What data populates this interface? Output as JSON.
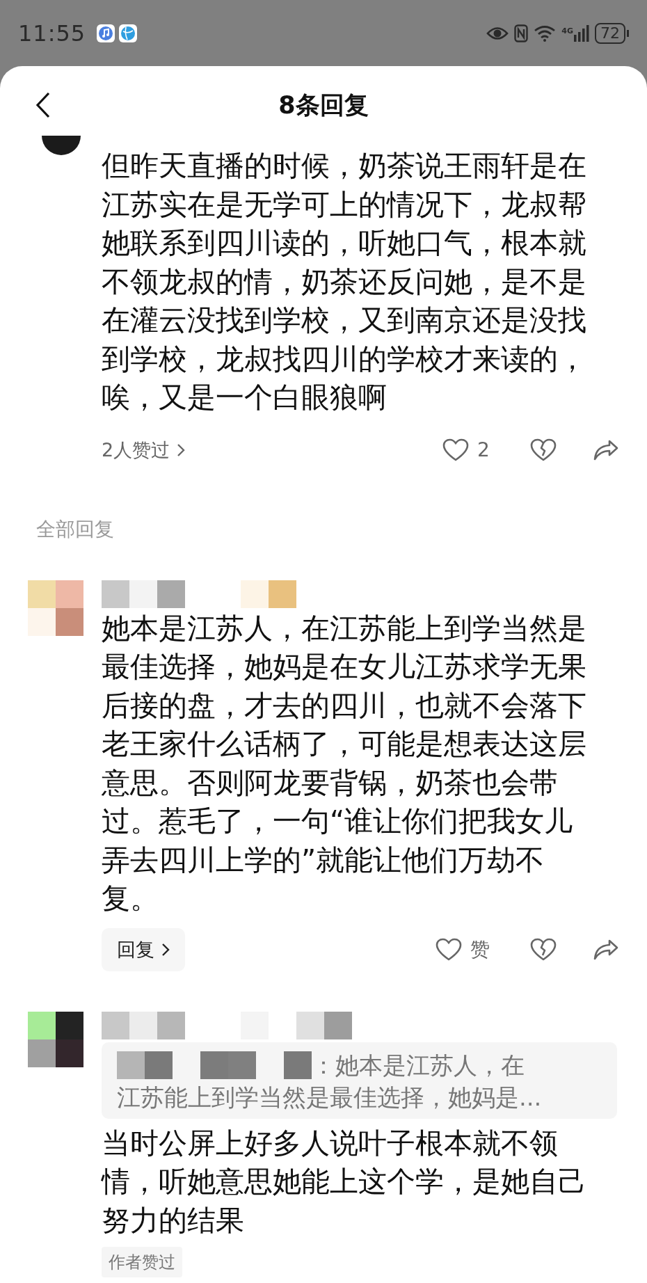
{
  "status_bar": {
    "time": "11:55",
    "network": "4G",
    "battery": "72"
  },
  "header": {
    "title": "8条回复"
  },
  "top_comment": {
    "text": "但昨天直播的时候，奶茶说王雨轩是在江苏实在是无学可上的情况下，龙叔帮她联系到四川读的，听她口气，根本就不领龙叔的情，奶茶还反问她，是不是在灌云没找到学校，又到南京还是没找到学校，龙叔找四川的学校才来读的，唉，又是一个白眼狼啊",
    "likers": "2人赞过",
    "like_count": "2"
  },
  "section_label": "全部回复",
  "replies": [
    {
      "kind": "plain",
      "text": "她本是江苏人，在江苏能上到学当然是最佳选择，她妈是在女儿江苏求学无果后接的盘，才去的四川，也就不会落下老王家什么话柄了，可能是想表达这层意思。否则阿龙要背锅，奶茶也会带过。惹毛了，一句“谁让你们把我女儿弄去四川上学的”就能让他们万劫不复。",
      "reply_label": "回复",
      "like_label": "赞"
    },
    {
      "kind": "quoted",
      "quote_start": "：她本是江苏人，在",
      "quote_rest": "江苏能上到学当然是最佳选择，她妈是...",
      "text": "当时公屏上好多人说叶子根本就不领情，听她意思她能上这个学，是她自己努力的结果",
      "tag": "作者赞过"
    }
  ]
}
